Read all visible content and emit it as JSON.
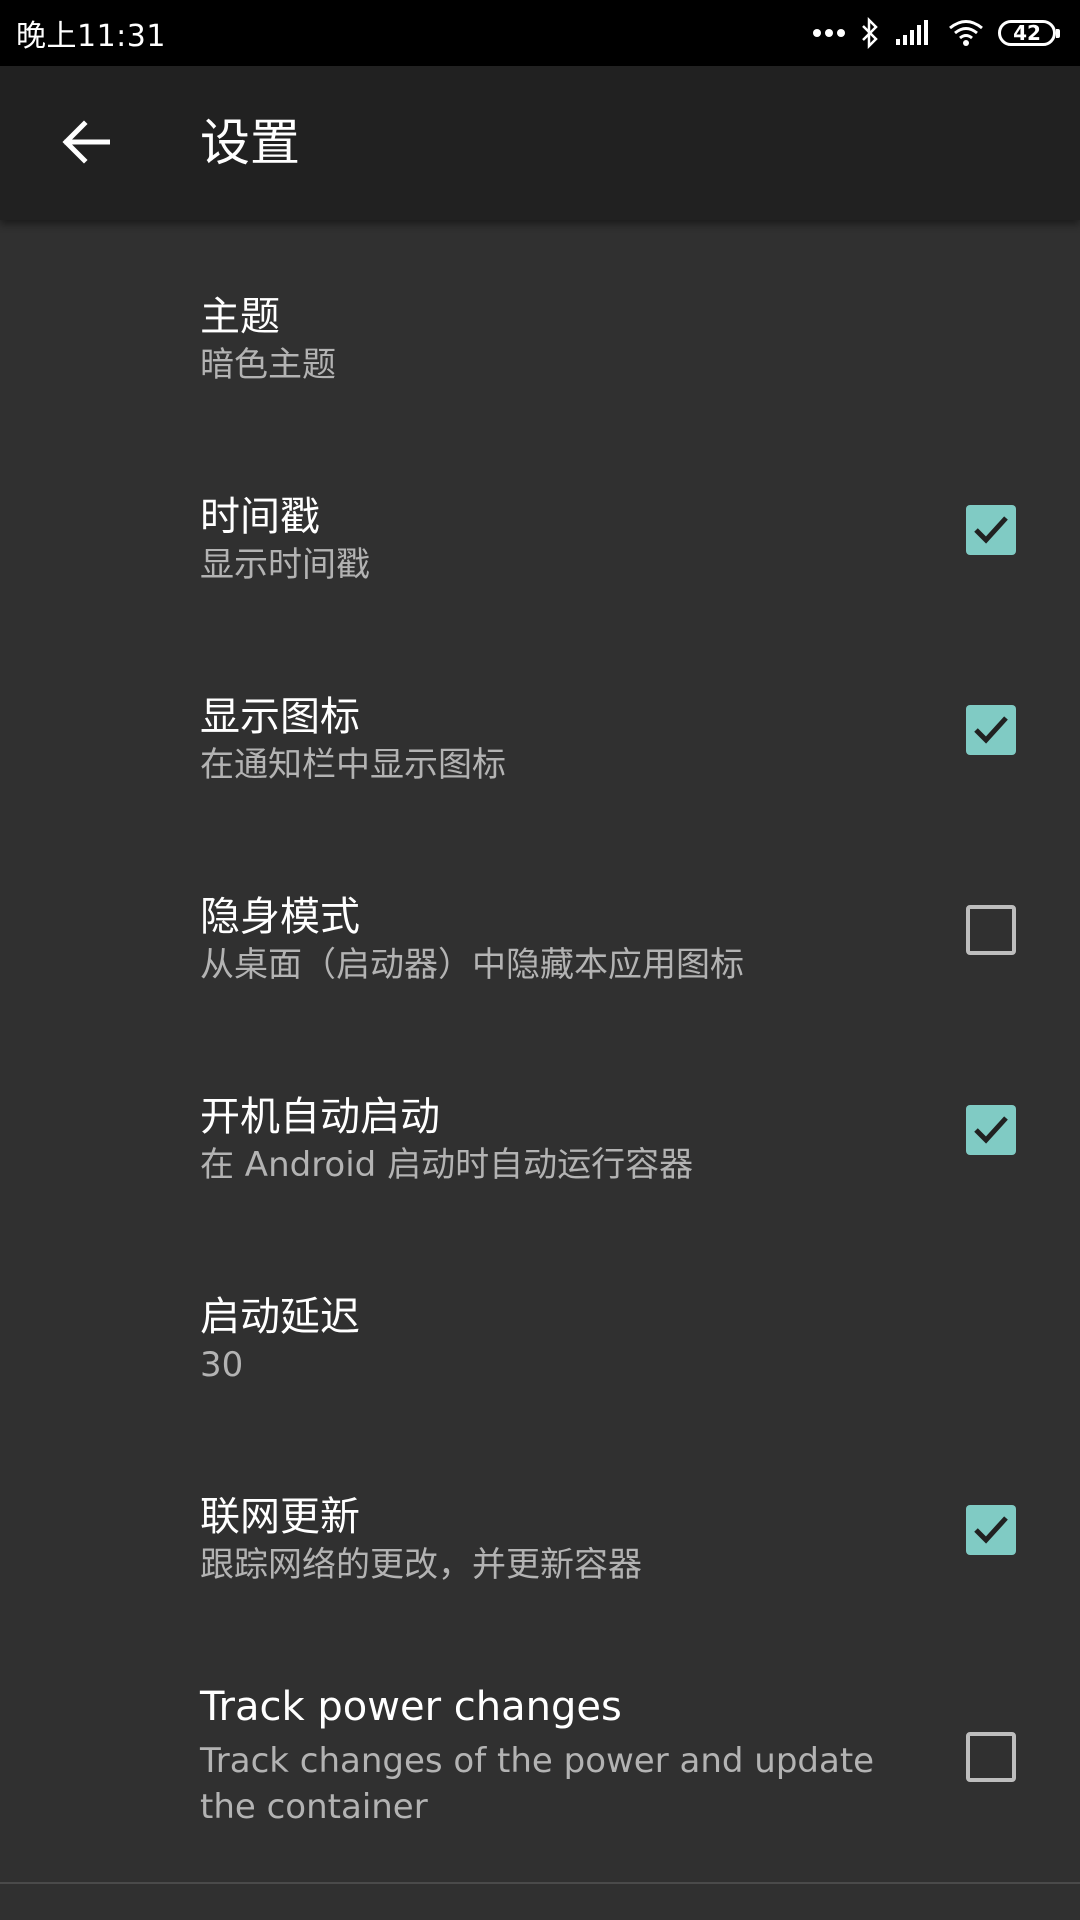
{
  "status_bar": {
    "time": "晚上11:31",
    "battery": "42"
  },
  "toolbar": {
    "title": "设置"
  },
  "colors": {
    "accent": "#80cbc4",
    "background": "#303030",
    "toolbar": "#212121"
  },
  "settings": [
    {
      "title": "主题",
      "summary": "暗色主题",
      "checkbox": "none"
    },
    {
      "title": "时间戳",
      "summary": "显示时间戳",
      "checkbox": "checked"
    },
    {
      "title": "显示图标",
      "summary": "在通知栏中显示图标",
      "checkbox": "checked"
    },
    {
      "title": "隐身模式",
      "summary": "从桌面（启动器）中隐藏本应用图标",
      "checkbox": "unchecked"
    },
    {
      "title": "开机自动启动",
      "summary": "在 Android 启动时自动运行容器",
      "checkbox": "checked"
    },
    {
      "title": "启动延迟",
      "summary": "30",
      "checkbox": "none"
    },
    {
      "title": "联网更新",
      "summary": "跟踪网络的更改，并更新容器",
      "checkbox": "checked"
    },
    {
      "title": "Track power changes",
      "summary": "Track changes of the power and update the container",
      "checkbox": "unchecked"
    }
  ]
}
